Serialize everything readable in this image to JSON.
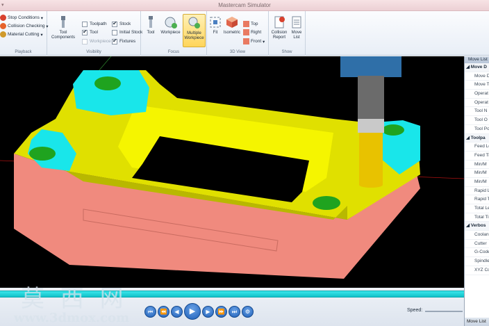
{
  "window": {
    "title": "Mastercam Simulator"
  },
  "ribbon": {
    "playback": {
      "label": "Playback",
      "items": [
        {
          "label": "Stop Conditions",
          "dropdown": true
        },
        {
          "label": "Collision Checking",
          "dropdown": true
        },
        {
          "label": "Material Cutting",
          "dropdown": true
        }
      ]
    },
    "visibility": {
      "label": "Visibility",
      "tool_components": "Tool Components",
      "checks": [
        {
          "label": "Toolpath",
          "checked": false,
          "enabled": true
        },
        {
          "label": "Tool",
          "checked": true,
          "enabled": true
        },
        {
          "label": "Workpiece",
          "checked": false,
          "enabled": false
        },
        {
          "label": "Stock",
          "checked": true,
          "enabled": true
        },
        {
          "label": "Initial Stock",
          "checked": false,
          "enabled": true
        },
        {
          "label": "Fixtures",
          "checked": true,
          "enabled": true
        }
      ]
    },
    "focus": {
      "label": "Focus",
      "buttons": [
        {
          "label": "Tool"
        },
        {
          "label": "Workpiece"
        },
        {
          "label": "Multiple Workpiece",
          "active": true
        }
      ]
    },
    "view3d": {
      "label": "3D View",
      "fit": "Fit",
      "isometric": "Isometric",
      "top": "Top",
      "right": "Right",
      "front": "Front"
    },
    "show": {
      "label": "Show",
      "collision_report": "Collision Report",
      "move_list": "Move List"
    }
  },
  "move_list": {
    "header": "Move List",
    "rows": [
      {
        "text": "Move D",
        "category": true
      },
      {
        "text": "Move D"
      },
      {
        "text": "Move T"
      },
      {
        "text": "Operat"
      },
      {
        "text": "Operat"
      },
      {
        "text": "Tool N"
      },
      {
        "text": "Tool O"
      },
      {
        "text": "Tool Po"
      },
      {
        "text": "Toolpa",
        "category": true
      },
      {
        "text": "Feed Le"
      },
      {
        "text": "Feed Ti"
      },
      {
        "text": "Min/M"
      },
      {
        "text": "Min/M"
      },
      {
        "text": "Min/M"
      },
      {
        "text": "Rapid L"
      },
      {
        "text": "Rapid T"
      },
      {
        "text": "Total Le"
      },
      {
        "text": "Total Ti"
      },
      {
        "text": "Verbos",
        "category": true
      },
      {
        "text": "Coolan"
      },
      {
        "text": "Cutter"
      },
      {
        "text": "G-Code"
      },
      {
        "text": "Spindle"
      },
      {
        "text": "XYZ Co"
      }
    ],
    "footer": "Move List"
  },
  "playback_controls": {
    "buttons": [
      "skip-to-start",
      "previous-operation",
      "step-back",
      "play",
      "step-forward",
      "next-operation",
      "skip-to-end",
      "options"
    ],
    "speed_label": "Speed:",
    "progress": 1.0
  },
  "watermark": {
    "main": "莫 西 网",
    "url": "www.3dmox.com"
  },
  "colors": {
    "viewport_bg": "#000000",
    "stock_top": "#e8e800",
    "stock_side": "#f08a7e",
    "fixture": "#19e6ea",
    "bore": "#1fa31f",
    "timeline": "#22d7dc"
  }
}
